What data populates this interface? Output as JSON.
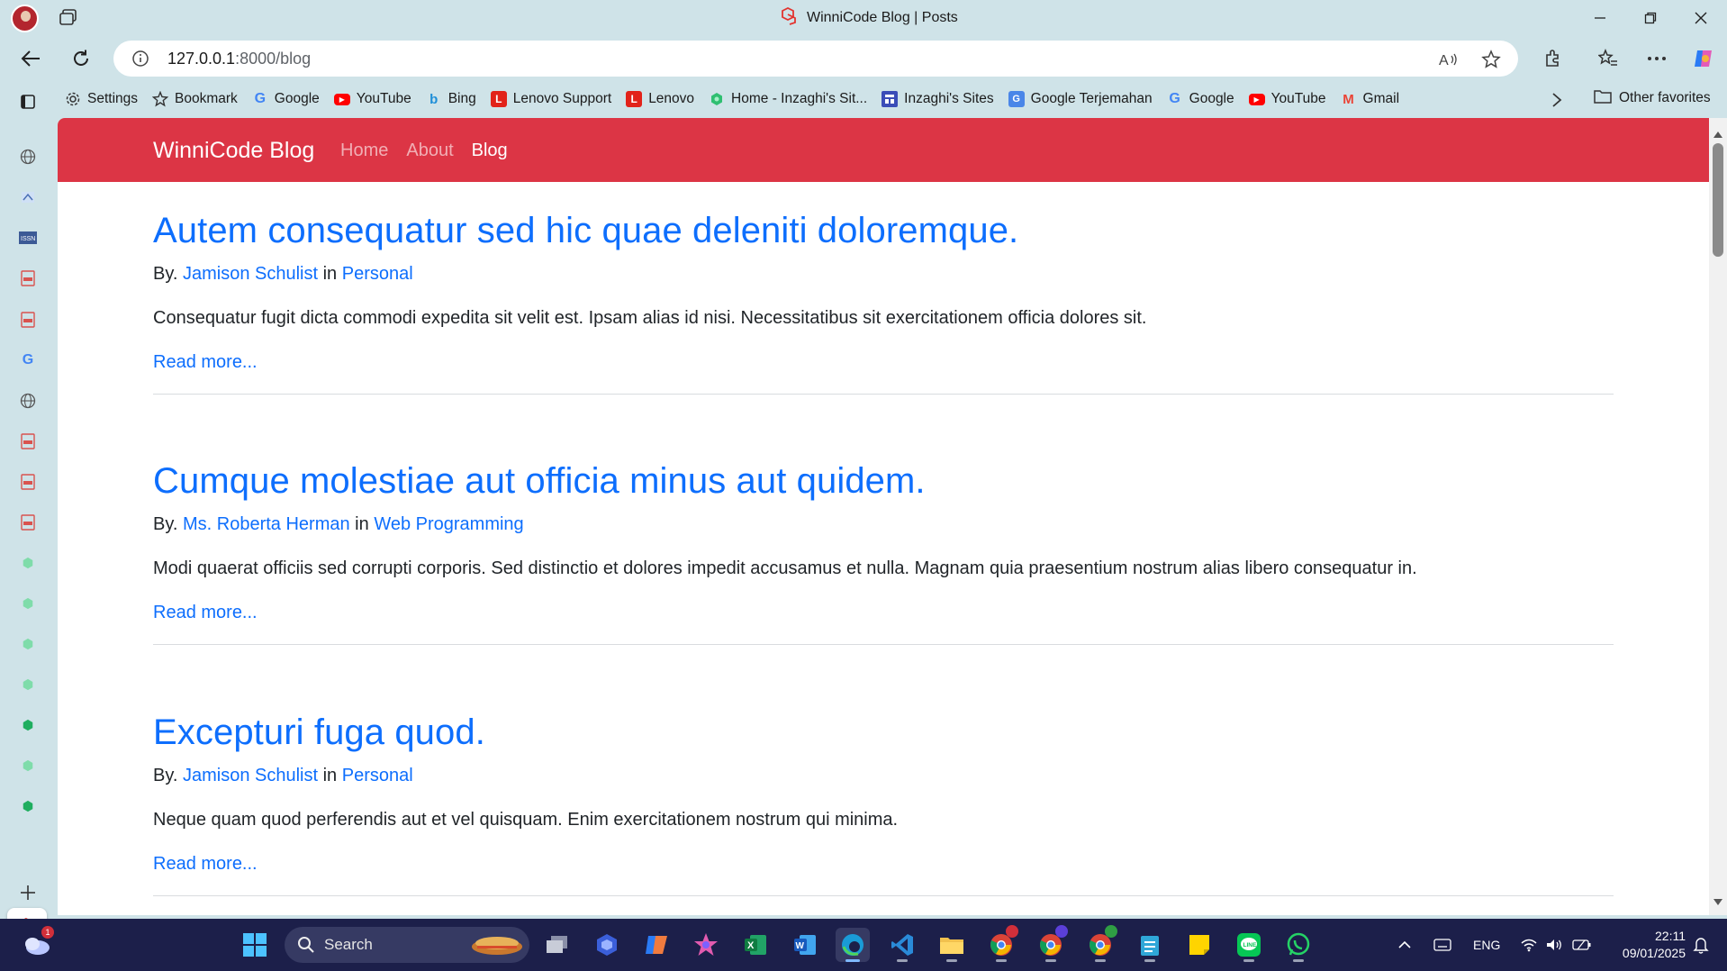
{
  "window": {
    "title": "WinniCode Blog | Posts"
  },
  "address_bar": {
    "url_host": "127.0.0.1",
    "url_rest": ":8000/blog"
  },
  "bookmarks": [
    {
      "label": "Settings",
      "icon": "gear-icon"
    },
    {
      "label": "Bookmark",
      "icon": "star-icon"
    },
    {
      "label": "Google",
      "icon": "google-icon"
    },
    {
      "label": "YouTube",
      "icon": "youtube-icon"
    },
    {
      "label": "Bing",
      "icon": "bing-icon"
    },
    {
      "label": "Lenovo Support",
      "icon": "lenovo-icon"
    },
    {
      "label": "Lenovo",
      "icon": "lenovo-icon"
    },
    {
      "label": "Home - Inzaghi's Sit...",
      "icon": "hexagon-icon"
    },
    {
      "label": "Inzaghi's Sites",
      "icon": "site-icon"
    },
    {
      "label": "Google Terjemahan",
      "icon": "translate-icon"
    },
    {
      "label": "Google",
      "icon": "google-icon"
    },
    {
      "label": "YouTube",
      "icon": "youtube-icon"
    },
    {
      "label": "Gmail",
      "icon": "gmail-icon"
    }
  ],
  "bookmarks_other": "Other favorites",
  "site": {
    "brand": "WinniCode Blog",
    "nav": [
      "Home",
      "About",
      "Blog"
    ],
    "active_nav": "Blog"
  },
  "posts": [
    {
      "title": "Autem consequatur sed hic quae deleniti doloremque.",
      "by": "By.",
      "author": "Jamison Schulist",
      "in": "in",
      "category": "Personal",
      "excerpt": "Consequatur fugit dicta commodi expedita sit velit est. Ipsam alias id nisi. Necessitatibus sit exercitationem officia dolores sit.",
      "read_more": "Read more..."
    },
    {
      "title": "Cumque molestiae aut officia minus aut quidem.",
      "by": "By.",
      "author": "Ms. Roberta Herman",
      "in": "in",
      "category": "Web Programming",
      "excerpt": "Modi quaerat officiis sed corrupti corporis. Sed distinctio et dolores impedit accusamus et nulla. Magnam quia praesentium nostrum alias libero consequatur in.",
      "read_more": "Read more..."
    },
    {
      "title": "Excepturi fuga quod.",
      "by": "By.",
      "author": "Jamison Schulist",
      "in": "in",
      "category": "Personal",
      "excerpt": "Neque quam quod perferendis aut et vel quisquam. Enim exercitationem nostrum qui minima.",
      "read_more": "Read more..."
    }
  ],
  "taskbar": {
    "search_label": "Search",
    "weather_badge": "1",
    "language": "ENG",
    "time": "22:11",
    "date": "09/01/2025"
  },
  "colors": {
    "navbar": "#dc3545",
    "link": "#0d6efd",
    "taskbar": "#1c1f4a",
    "chrome": "#cfe3e8"
  }
}
